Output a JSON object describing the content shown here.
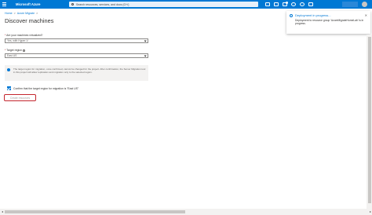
{
  "topbar": {
    "brand": "Microsoft Azure",
    "search_placeholder": "Search resources, services, and docs (G+/)",
    "icons": [
      "cloud-shell-icon",
      "directory-filter-icon",
      "notifications-icon",
      "settings-icon",
      "help-icon",
      "feedback-icon"
    ]
  },
  "breadcrumb": {
    "home": "Home",
    "azure_migrate": "Azure Migrate"
  },
  "page": {
    "title": "Discover machines",
    "virtualized_label": "Are your machines virtualized?",
    "virtualized_value": "Yes, with Hyper-V",
    "target_region_label": "Target region",
    "target_region_value": "East US",
    "info_text": "The target region for migration, once confirmed, cannot be changed for the project. After confirmation, the Server Migration tool in this project will allow replication and migration only to the selected region.",
    "confirm_label": "Confirm that the target region for migration is \"East US\"",
    "create_button": "Create resources"
  },
  "toast": {
    "title": "Deployment in progress...",
    "message": "Deployment to resource group 'AzureMigrateHomeLab' is in progress."
  },
  "colors": {
    "accent": "#0078d4",
    "highlight": "#c4262e"
  }
}
